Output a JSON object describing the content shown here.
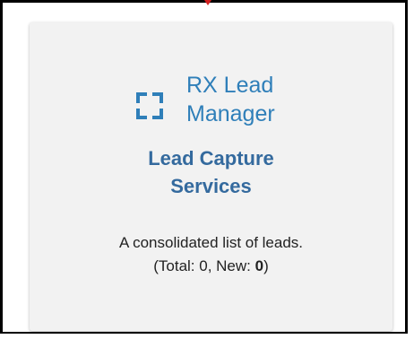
{
  "card": {
    "icon": "bracket-frame-icon",
    "app_name_line1": "RX Lead",
    "app_name_line2": "Manager",
    "subtitle_line1": "Lead Capture",
    "subtitle_line2": "Services",
    "description": "A consolidated list of leads.",
    "totals_prefix": "(Total: 0, New: ",
    "new_count": "0",
    "totals_suffix": ")"
  },
  "colors": {
    "accent": "#2f7fb9",
    "subtitle": "#346a9e",
    "card_bg": "#f2f2f2",
    "frame": "#000000",
    "marker": "#d21f1f"
  }
}
